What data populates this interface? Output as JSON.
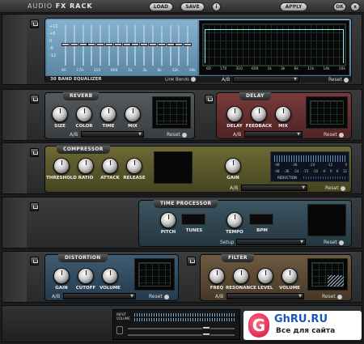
{
  "topbar": {
    "title_main": "AUDIO",
    "title_bold": "FX RACK",
    "load": "LOAD",
    "save": "SAVE",
    "info": "i",
    "apply": "APPLY",
    "ok": "OK",
    "close": "x"
  },
  "eq": {
    "name": "30 BAND EQUALIZER",
    "link": "Link Bands",
    "ab": "A/B",
    "reset": "Reset",
    "db_labels": [
      "+12",
      "+6",
      "0",
      "-6",
      "-12"
    ],
    "freq_left": [
      "60",
      "170",
      "310",
      "600",
      "1k",
      "3k",
      "6k",
      "12k",
      "16k"
    ],
    "freq_right": [
      "60",
      "170",
      "310",
      "600",
      "1k",
      "3k",
      "6k",
      "12k",
      "14k",
      "16k"
    ]
  },
  "reverb": {
    "title": "REVERB",
    "knobs": [
      "SIZE",
      "COLOR",
      "TIME",
      "MIX"
    ],
    "ab": "A/B",
    "reset": "Reset"
  },
  "delay": {
    "title": "DELAY",
    "knobs": [
      "DELAY",
      "FEEDBACK",
      "MIX"
    ],
    "ab": "A/B",
    "reset": "Reset"
  },
  "compressor": {
    "title": "COMPRESSOR",
    "knobs": [
      "THRESHOLD",
      "RATIO",
      "ATTACK",
      "RELEASE"
    ],
    "gain": "GAIN",
    "ab": "A/B",
    "reset": "Reset",
    "meter_top": [
      "-48",
      "-36",
      "-24",
      "-12",
      "0"
    ],
    "meter_scale": [
      "-48",
      "-36",
      "-24",
      "-15",
      "-10",
      "-6",
      "0",
      "6",
      "12"
    ],
    "meter_label": "REDUCTION"
  },
  "time": {
    "title": "TIME PROCESSOR",
    "knobs": [
      "PITCH",
      "TEMPO"
    ],
    "tunes": "TUNES",
    "bpm": "BPM",
    "setup": "Setup",
    "reset": "Reset"
  },
  "distortion": {
    "title": "DISTORTION",
    "knobs": [
      "GAIN",
      "CUTOFF",
      "VOLUME"
    ],
    "ab": "A/B",
    "reset": "Reset"
  },
  "filter": {
    "title": "FILTER",
    "knobs": [
      "FREQ",
      "RESONANCE",
      "LEVEL",
      "VOLUME"
    ],
    "ab": "A/B",
    "reset": "Reset"
  },
  "master": {
    "input": "INPUT",
    "volume": "VOLUME"
  },
  "watermark": {
    "site": "GhRU.RU",
    "tagline": "Все для сайта"
  }
}
